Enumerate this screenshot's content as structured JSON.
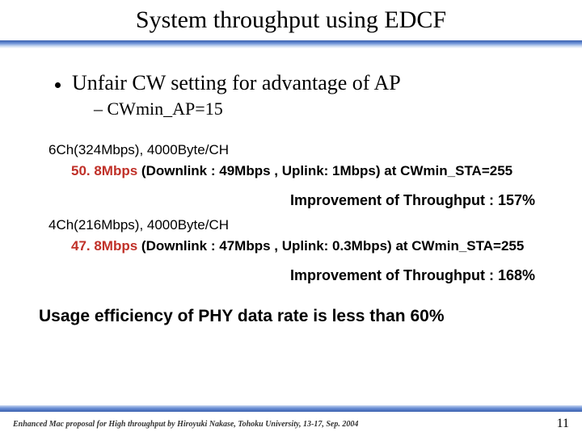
{
  "title": "System throughput using EDCF",
  "bullet1": "Unfair CW setting for advantage of AP",
  "bullet2": "– CWmin_AP=15",
  "case1": {
    "config": "6Ch(324Mbps),  4000Byte/CH",
    "total": "50. 8Mbps ",
    "rest": "(Downlink : 49Mbps , Uplink: 1Mbps) at CWmin_STA=255",
    "improve": "Improvement of Throughput : 157%"
  },
  "case2": {
    "config": "4Ch(216Mbps),  4000Byte/CH",
    "total": "47. 8Mbps ",
    "rest": "(Downlink : 47Mbps , Uplink: 0.3Mbps) at CWmin_STA=255",
    "improve": "Improvement of Throughput : 168%"
  },
  "summary": "Usage efficiency of PHY data rate is less than 60%",
  "footer": {
    "left": "Enhanced Mac proposal for High throughput by Hiroyuki Nakase, Tohoku University, 13-17, Sep. 2004",
    "page": "11"
  }
}
